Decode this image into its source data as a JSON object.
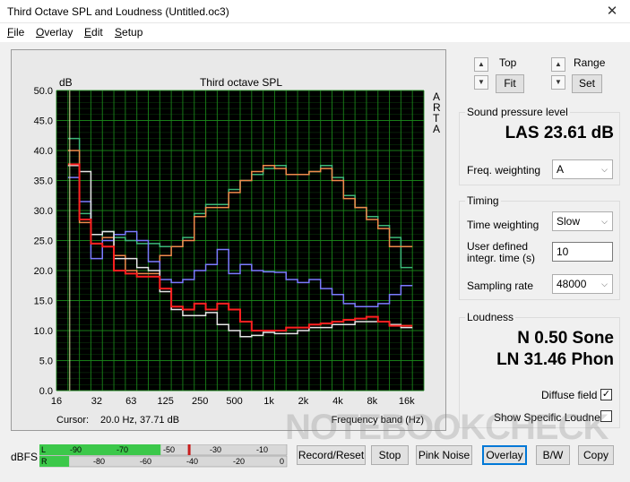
{
  "window": {
    "title": "Third Octave SPL and Loudness (Untitled.oc3)",
    "close_glyph": "✕"
  },
  "menu": [
    {
      "label": "File",
      "mnemonic": "F",
      "rest": "ile"
    },
    {
      "label": "Overlay",
      "mnemonic": "O",
      "rest": "verlay"
    },
    {
      "label": "Edit",
      "mnemonic": "E",
      "rest": "dit"
    },
    {
      "label": "Setup",
      "mnemonic": "S",
      "rest": "etup"
    }
  ],
  "plot": {
    "title": "Third octave SPL",
    "unit_label": "dB",
    "side_text": [
      "A",
      "R",
      "T",
      "A"
    ],
    "cursor_label": "Cursor:",
    "cursor_value": "20.0 Hz, 37.71 dB",
    "x_axis_label": "Frequency band (Hz)",
    "background": "#000000",
    "grid_color": "#1b8a1b"
  },
  "chart_data": {
    "type": "line",
    "title": "Third octave SPL",
    "ylabel": "dB",
    "xlabel": "Frequency band (Hz)",
    "ylim": [
      0,
      50
    ],
    "y_ticks": [
      "0.0",
      "5.0",
      "10.0",
      "15.0",
      "20.0",
      "25.0",
      "30.0",
      "35.0",
      "40.0",
      "45.0",
      "50.0"
    ],
    "x_ticks": [
      "16",
      "32",
      "63",
      "125",
      "250",
      "500",
      "1k",
      "2k",
      "4k",
      "8k",
      "16k"
    ],
    "bands": [
      "16",
      "20",
      "25",
      "31.5",
      "40",
      "50",
      "63",
      "80",
      "100",
      "125",
      "160",
      "200",
      "250",
      "315",
      "400",
      "500",
      "630",
      "800",
      "1k",
      "1.25k",
      "1.6k",
      "2k",
      "2.5k",
      "3.15k",
      "4k",
      "5k",
      "6.3k",
      "8k",
      "10k",
      "12.5k",
      "16k",
      "20k"
    ],
    "grid": true,
    "series": [
      {
        "color": "#3cb878",
        "values": [
          null,
          42.0,
          29.5,
          24.5,
          26.5,
          25.5,
          25.0,
          24.5,
          24.5,
          24.0,
          24.0,
          25.5,
          29.5,
          31.0,
          31.0,
          33.5,
          35.0,
          36.0,
          37.0,
          37.5,
          36.0,
          36.0,
          36.5,
          37.5,
          35.5,
          32.5,
          30.5,
          29.0,
          27.5,
          25.5,
          20.5,
          null
        ]
      },
      {
        "color": "#f08a4b",
        "values": [
          null,
          40.0,
          28.0,
          24.5,
          25.5,
          22.5,
          20.0,
          19.5,
          19.5,
          22.5,
          24.0,
          25.0,
          29.0,
          30.5,
          30.5,
          33.0,
          35.0,
          36.5,
          37.5,
          37.0,
          36.0,
          36.0,
          36.5,
          37.0,
          35.0,
          32.0,
          30.5,
          28.5,
          27.0,
          24.0,
          24.0,
          null
        ]
      },
      {
        "color": "#7b7bff",
        "values": [
          null,
          35.5,
          31.5,
          22.0,
          25.0,
          26.0,
          26.5,
          25.0,
          21.5,
          18.5,
          18.0,
          18.5,
          20.0,
          21.0,
          23.5,
          19.5,
          21.0,
          20.0,
          19.8,
          19.7,
          18.5,
          18.0,
          18.5,
          17.0,
          16.0,
          14.5,
          14.0,
          14.0,
          14.5,
          16.0,
          17.5,
          null
        ]
      },
      {
        "color": "#e6e6e6",
        "values": [
          null,
          37.5,
          36.5,
          26.0,
          26.5,
          22.0,
          22.0,
          20.5,
          20.0,
          16.5,
          13.5,
          12.5,
          12.5,
          13.0,
          11.0,
          10.0,
          9.0,
          9.2,
          9.7,
          9.5,
          9.5,
          10.0,
          10.5,
          10.5,
          11.0,
          11.0,
          11.5,
          11.5,
          11.5,
          11.0,
          10.5,
          null
        ]
      },
      {
        "color": "#ff2020",
        "values": [
          null,
          37.7,
          28.5,
          24.5,
          24.0,
          20.0,
          19.5,
          19.0,
          19.0,
          17.0,
          14.0,
          13.5,
          14.5,
          13.5,
          14.5,
          13.5,
          11.5,
          10.0,
          10.0,
          10.0,
          10.5,
          10.5,
          11.0,
          11.2,
          11.5,
          11.8,
          12.0,
          12.3,
          11.5,
          10.8,
          10.8,
          null
        ]
      }
    ]
  },
  "controls": {
    "top_label": "Top",
    "range_label": "Range",
    "fit_label": "Fit",
    "set_label": "Set",
    "up_glyph": "▲",
    "down_glyph": "▼"
  },
  "spl_group": {
    "title": "Sound pressure level",
    "value": "LAS 23.61 dB",
    "weighting_label": "Freq. weighting",
    "weighting_value": "A"
  },
  "timing_group": {
    "title": "Timing",
    "time_weighting_label": "Time weighting",
    "time_weighting_value": "Slow",
    "integr_label_1": "User defined",
    "integr_label_2": "integr. time (s)",
    "integr_value": "10",
    "sampling_label": "Sampling rate",
    "sampling_value": "48000"
  },
  "loudness_group": {
    "title": "Loudness",
    "sone": "N 0.50 Sone",
    "phon": "LN 31.46 Phon",
    "diffuse_label": "Diffuse field",
    "diffuse_checked": "✓",
    "specific_label": "Show Specific Loudness"
  },
  "meter": {
    "label": "dBFS",
    "row1_ticks": [
      "L",
      "-90",
      "-70",
      "-50",
      "-30",
      "-10"
    ],
    "row2_ticks": [
      "R",
      "-80",
      "-60",
      "-40",
      "-20",
      "0"
    ],
    "level_fraction": 0.49
  },
  "buttons": [
    "Record/Reset",
    "Stop",
    "Pink Noise",
    "Overlay",
    "B/W",
    "Copy"
  ],
  "watermark": "NOTEBOOKCHECK"
}
